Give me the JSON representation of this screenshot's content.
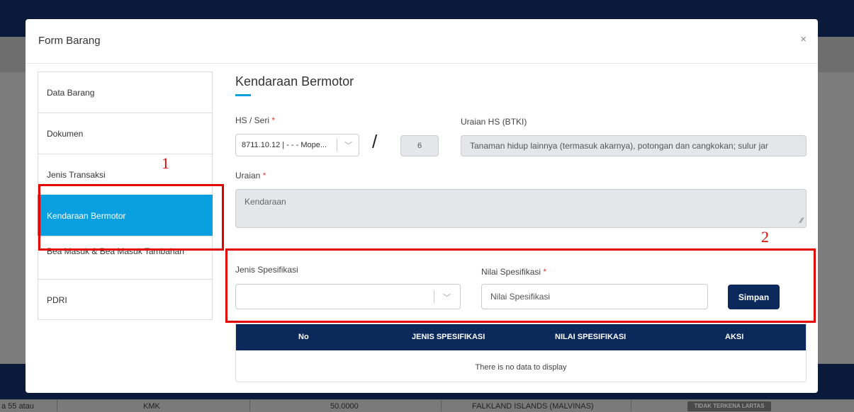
{
  "background": {
    "row_cells": [
      "a 55 atau",
      "KMK",
      "50.0000",
      "FALKLAND ISLANDS (MALVINAS)"
    ],
    "badge": "TIDAK TERKENA LARTAS"
  },
  "modal": {
    "title": "Form Barang",
    "close_icon": "×"
  },
  "nav": {
    "items": [
      {
        "label": "Data Barang",
        "active": false
      },
      {
        "label": "Dokumen",
        "active": false
      },
      {
        "label": "Jenis Transaksi",
        "active": false
      },
      {
        "label": "Kendaraan Bermotor",
        "active": true
      },
      {
        "label": "Bea Masuk & Bea Masuk Tambahan",
        "active": false
      },
      {
        "label": "PDRI",
        "active": false
      }
    ]
  },
  "section": {
    "title": "Kendaraan Bermotor"
  },
  "hs": {
    "label": "HS / Seri",
    "required_mark": "*",
    "value": "8711.10.12 | - - - Mope...",
    "separator": "/",
    "seri_value": "6"
  },
  "uraian_hs": {
    "label": "Uraian HS (BTKI)",
    "value": "Tanaman hidup lainnya (termasuk akarnya), potongan dan cangkokan; sulur jar"
  },
  "uraian": {
    "label": "Uraian",
    "required_mark": "*",
    "value": "Kendaraan"
  },
  "spesifikasi": {
    "jenis_label": "Jenis Spesifikasi",
    "jenis_value": "",
    "nilai_label": "Nilai Spesifikasi",
    "required_mark": "*",
    "nilai_placeholder": "Nilai Spesifikasi",
    "save_label": "Simpan"
  },
  "table": {
    "headers": [
      "No",
      "JENIS SPESIFIKASI",
      "NILAI SPESIFIKASI",
      "AKSI"
    ],
    "empty_text": "There is no data to display"
  },
  "annotations": {
    "one": "1",
    "two": "2"
  },
  "colors": {
    "accent": "#0aa0e0",
    "navy": "#0b2a5b",
    "highlight": "#e20000"
  }
}
